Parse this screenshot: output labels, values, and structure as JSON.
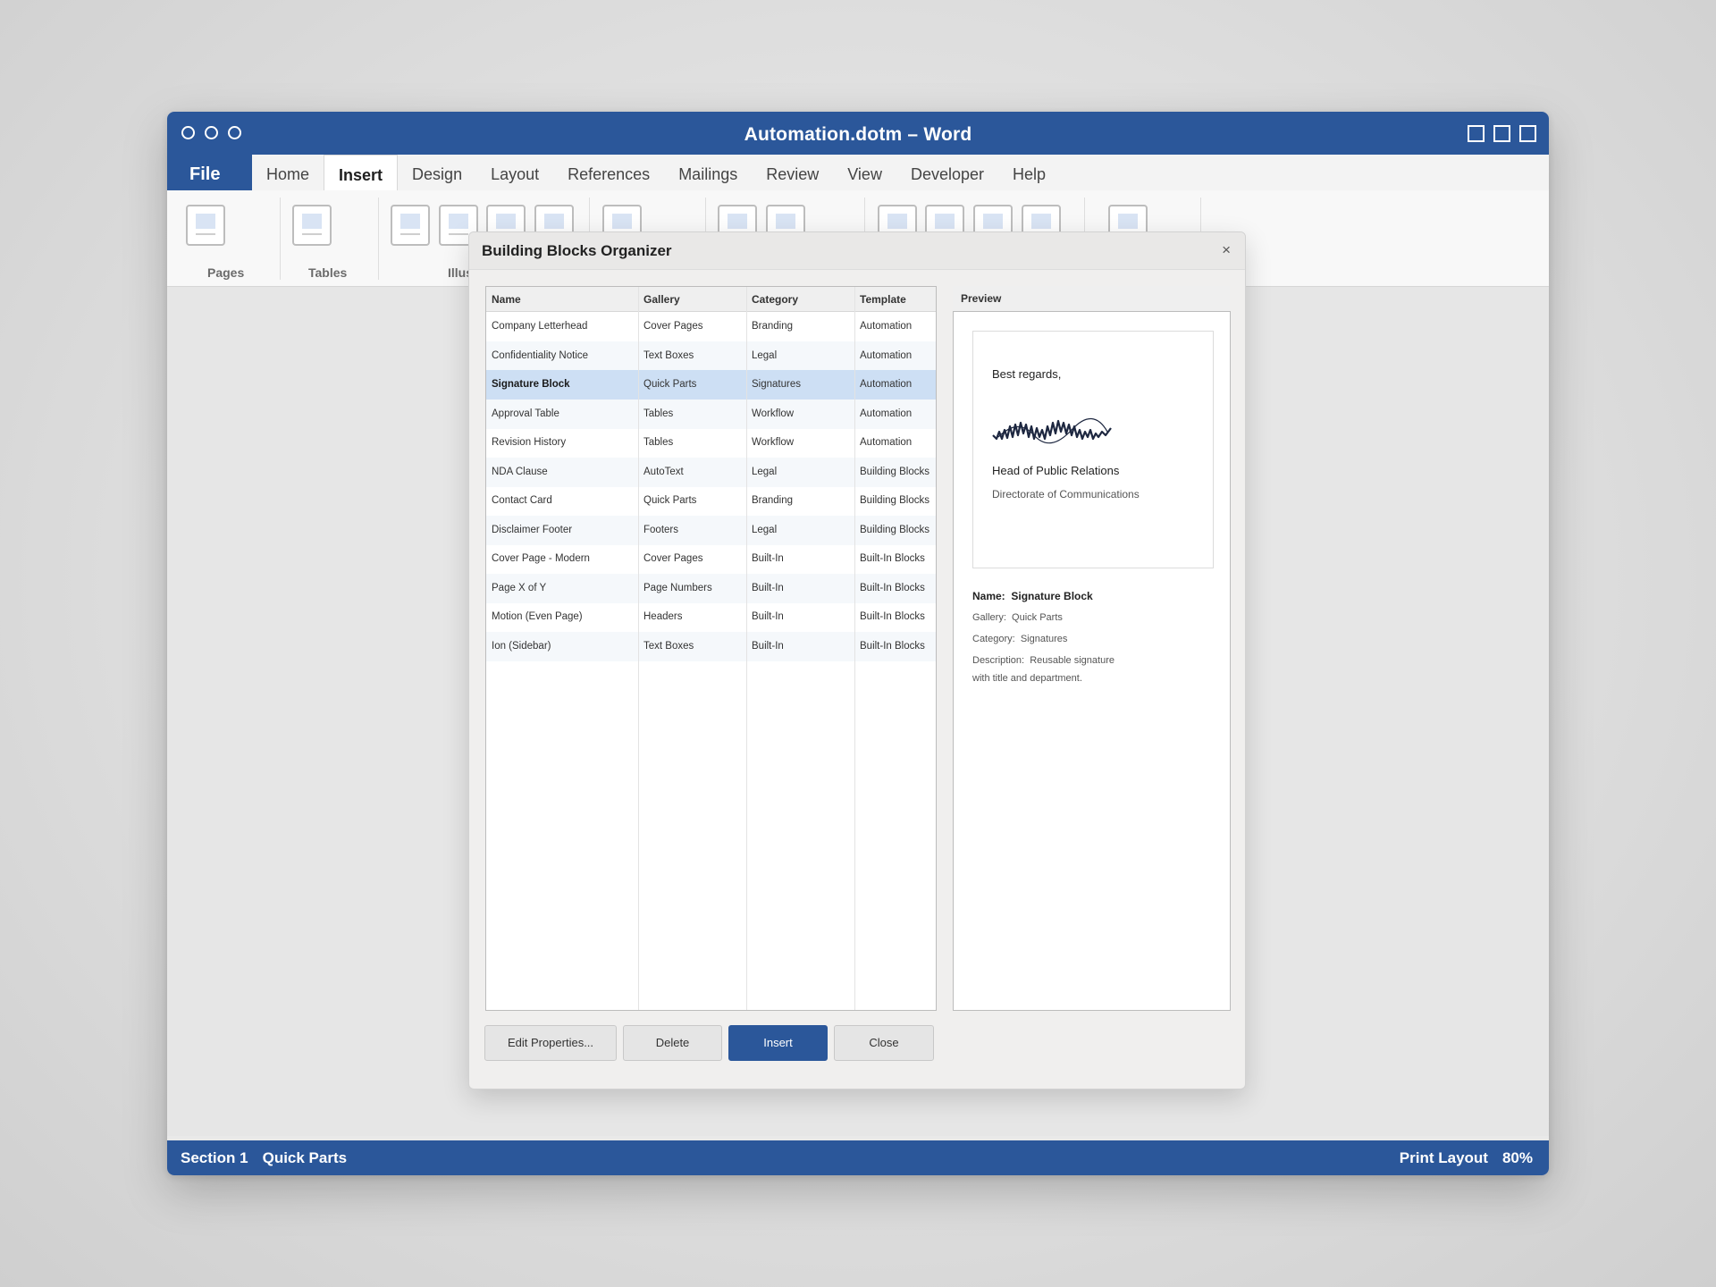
{
  "window": {
    "title": "Automation.dotm – Word"
  },
  "tabs": {
    "file": "File",
    "items": [
      "Home",
      "Insert",
      "Design",
      "Layout",
      "References",
      "Mailings",
      "Review",
      "View",
      "Developer",
      "Help"
    ],
    "active": "Insert"
  },
  "ribbon": {
    "groups": [
      "Pages",
      "Tables",
      "Illus"
    ]
  },
  "dialog": {
    "title": "Building Blocks Organizer",
    "close_glyph": "×",
    "columns": [
      "Name",
      "Gallery",
      "Category",
      "Template"
    ],
    "rows": [
      [
        "Company Letterhead",
        "Cover Pages",
        "Branding",
        "Automation"
      ],
      [
        "Confidentiality Notice",
        "Text Boxes",
        "Legal",
        "Automation"
      ],
      [
        "Signature Block",
        "Quick Parts",
        "Signatures",
        "Automation"
      ],
      [
        "Approval Table",
        "Tables",
        "Workflow",
        "Automation"
      ],
      [
        "Revision History",
        "Tables",
        "Workflow",
        "Automation"
      ],
      [
        "NDA Clause",
        "AutoText",
        "Legal",
        "Building Blocks"
      ],
      [
        "Contact Card",
        "Quick Parts",
        "Branding",
        "Building Blocks"
      ],
      [
        "Disclaimer Footer",
        "Footers",
        "Legal",
        "Building Blocks"
      ],
      [
        "Cover Page - Modern",
        "Cover Pages",
        "Built-In",
        "Built-In Blocks"
      ],
      [
        "Page X of Y",
        "Page Numbers",
        "Built-In",
        "Built-In Blocks"
      ],
      [
        "Motion (Even Page)",
        "Headers",
        "Built-In",
        "Built-In Blocks"
      ],
      [
        "Ion (Sidebar)",
        "Text Boxes",
        "Built-In",
        "Built-In Blocks"
      ]
    ],
    "selected_row": 2,
    "preview": {
      "label": "Preview",
      "regards": "Best regards,",
      "signer_title": "Head of Public Relations",
      "department": "Directorate of Communications",
      "name_label": "Name:",
      "name_value": "Signature Block",
      "gallery_label": "Gallery:",
      "gallery_value": "Quick Parts",
      "category_label": "Category:",
      "category_value": "Signatures",
      "description_label": "Description:",
      "description_line1": "Reusable signature",
      "description_line2": "with title and department."
    },
    "buttons": {
      "edit": "Edit Properties...",
      "delete": "Delete",
      "insert": "Insert",
      "close": "Close"
    }
  },
  "status": {
    "section": "Section 1",
    "gallery": "Quick Parts",
    "view": "Print Layout",
    "zoom": "80%"
  },
  "colors": {
    "accent": "#2b579a",
    "selection": "#cddff4"
  }
}
